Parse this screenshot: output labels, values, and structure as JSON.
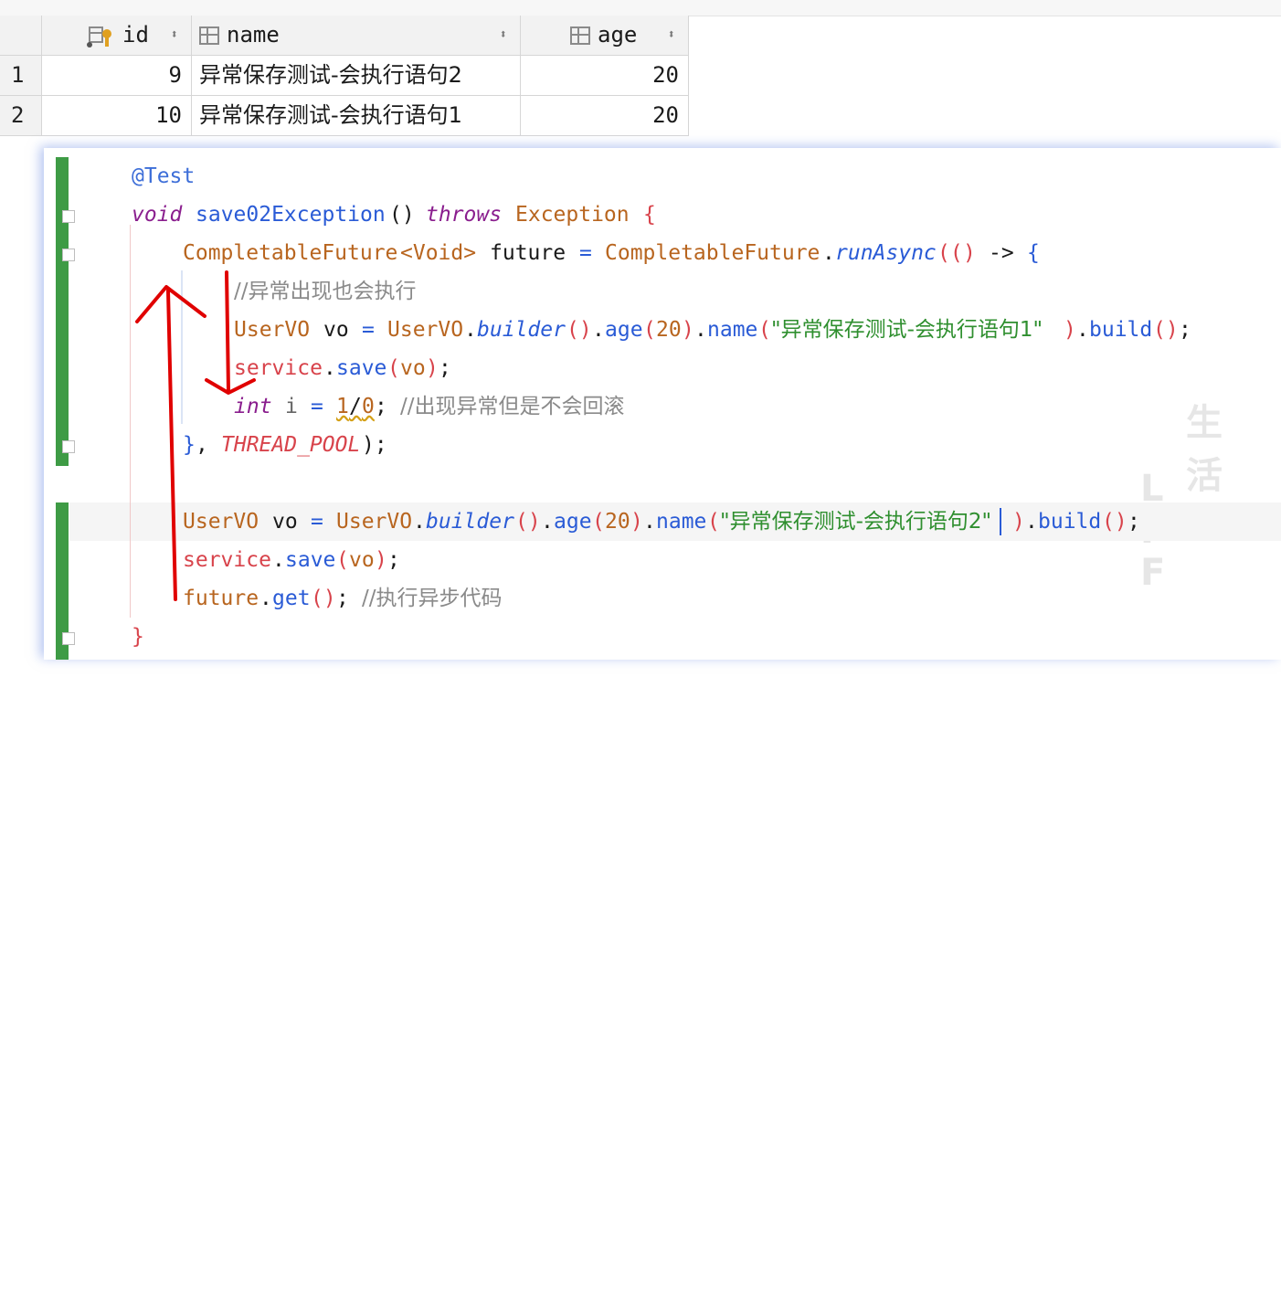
{
  "grid": {
    "columns": [
      {
        "label": "id",
        "icon": "primary-key-icon"
      },
      {
        "label": "name",
        "icon": "column-icon"
      },
      {
        "label": "age",
        "icon": "column-icon"
      }
    ],
    "sort_glyph": "⬍",
    "rows": [
      {
        "num": "1",
        "id": "9",
        "name": "异常保存测试-会执行语句2",
        "age": "20"
      },
      {
        "num": "2",
        "id": "10",
        "name": "异常保存测试-会执行语句1",
        "age": "20"
      }
    ]
  },
  "code": {
    "l1": {
      "ann": "@Test"
    },
    "l2": {
      "kw1": "void",
      "fn": "save02Exception",
      "p": "()",
      "kw2": "throws",
      "ty": "Exception",
      "b": "{"
    },
    "l3": {
      "ty1": "CompletableFuture",
      "gen": "<Void>",
      "var": "future",
      "eq": "=",
      "ty2": "CompletableFuture",
      "dot": ".",
      "m": "runAsync",
      "p1": "((",
      "p2": ")",
      "arrow": "->",
      "b": "{"
    },
    "l4": {
      "cmt": "//异常出现也会执行"
    },
    "l5": {
      "ty1": "UserVO",
      "var": "vo",
      "eq": "=",
      "ty2": "UserVO",
      "m1": "builder",
      "m2": "age",
      "n": "20",
      "m3": "name",
      "s": "\"异常保存测试-会执行语句1\"",
      "m4": "build",
      "end": ";"
    },
    "l6": {
      "obj": "service",
      "m": "save",
      "arg": "vo"
    },
    "l7": {
      "kw": "int",
      "var": "i",
      "eq": "=",
      "n1": "1",
      "op": "/",
      "n2": "0",
      "semi": ";",
      "cmt": "//出现异常但是不会回滚"
    },
    "l8": {
      "b": "}",
      "comma": ",",
      "cnst": "THREAD_POOL",
      "end": ");"
    },
    "l10": {
      "ty1": "UserVO",
      "var": "vo",
      "eq": "=",
      "ty2": "UserVO",
      "m1": "builder",
      "m2": "age",
      "n": "20",
      "m3": "name",
      "s": "\"异常保存测试-会执行语句2\"",
      "m4": "build",
      "end": ";"
    },
    "l11": {
      "obj": "service",
      "m": "save",
      "arg": "vo"
    },
    "l12": {
      "obj": "future",
      "m": "get",
      "cmt": "//执行异步代码"
    },
    "l13": {
      "b": "}"
    }
  },
  "watermark": {
    "top": "生 活",
    "bottom": "L I F"
  },
  "colors": {
    "annotation": "#d80000",
    "vcs_added": "#3e9b45",
    "keyword": "#8a1e8e",
    "string": "#2f8f2f"
  }
}
